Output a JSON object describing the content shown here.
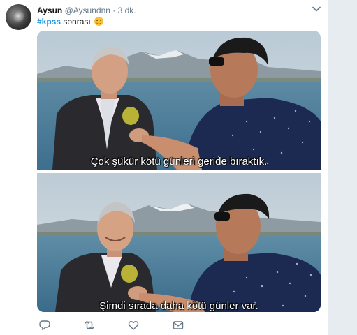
{
  "tweet": {
    "display_name": "Aysun",
    "handle": "@Aysundnn",
    "separator": "·",
    "time": "3 dk.",
    "text_hashtag": "#kpss",
    "text_rest": " sonrası",
    "emoji": "grinning-face"
  },
  "media": {
    "frames": [
      {
        "subtitle": "Çok şükür kötü günleri geride bıraktık."
      },
      {
        "subtitle": "Şimdi sırada daha kötü günler var."
      }
    ]
  },
  "actions": [
    "reply-icon",
    "retweet-icon",
    "like-icon",
    "direct-message-icon"
  ],
  "colors": {
    "link": "#1b95e0",
    "text": "#14171a",
    "secondary": "#657786",
    "background": "#e6ecf0"
  }
}
